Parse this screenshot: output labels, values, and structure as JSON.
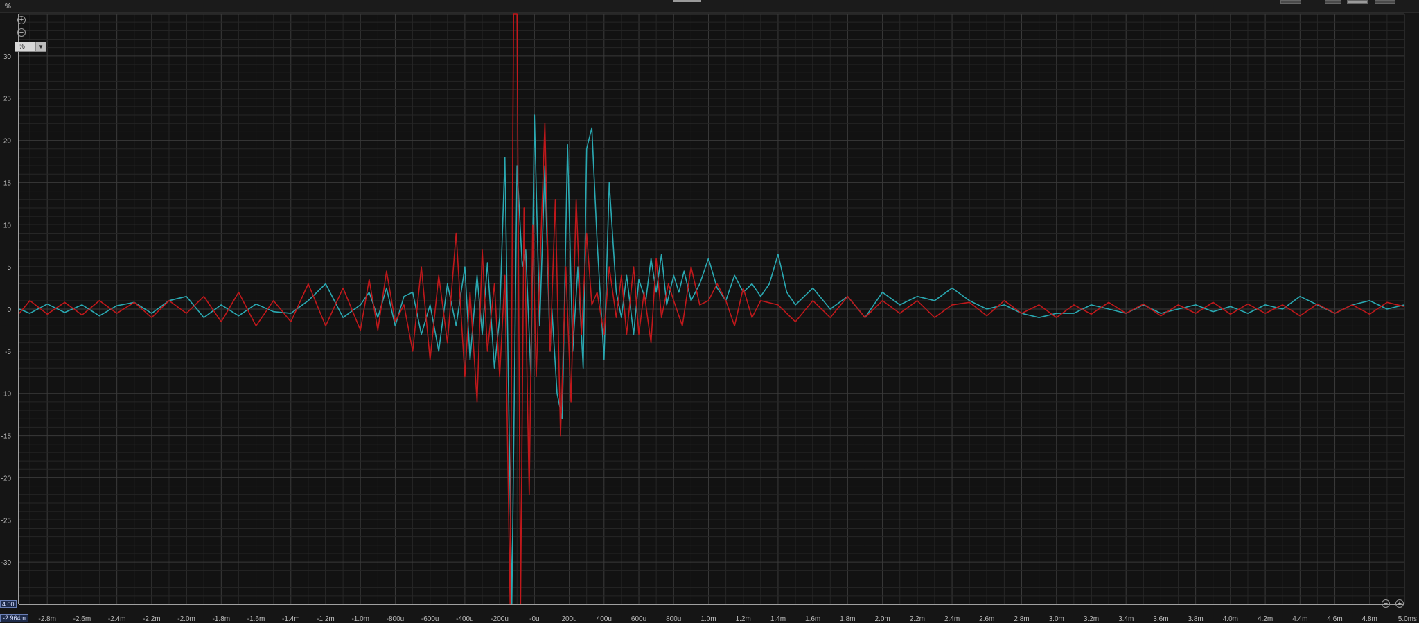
{
  "toolbar": {
    "unit_label": "%"
  },
  "controls": {
    "zoom_in_icon": "circle-plus-icon",
    "zoom_out_icon": "circle-minus-icon",
    "unit_select_value": "%",
    "cursor_x_readout": "-2.964m",
    "cursor_y_readout": "4.00"
  },
  "colors": {
    "background": "#121212",
    "grid_major": "#3a3a3a",
    "grid_minor": "#262626",
    "series_cyan": "#2aa9b2",
    "series_red": "#c0181b"
  },
  "chart_data": {
    "type": "line",
    "title": "",
    "xlabel": "",
    "ylabel": "%",
    "xlim": [
      -2.964,
      5.0
    ],
    "ylim": [
      -35,
      35
    ],
    "grid": true,
    "x_ticks": [
      "-2.8m",
      "-2.6m",
      "-2.4m",
      "-2.2m",
      "-2.0m",
      "-1.8m",
      "-1.6m",
      "-1.4m",
      "-1.2m",
      "-1.0m",
      "-800u",
      "-600u",
      "-400u",
      "-200u",
      "-0u",
      "200u",
      "400u",
      "600u",
      "800u",
      "1.0m",
      "1.2m",
      "1.4m",
      "1.6m",
      "1.8m",
      "2.0m",
      "2.2m",
      "2.4m",
      "2.6m",
      "2.8m",
      "3.0m",
      "3.2m",
      "3.4m",
      "3.6m",
      "3.8m",
      "4.0m",
      "4.2m",
      "4.4m",
      "4.6m",
      "4.8m",
      "5.0ms"
    ],
    "x_tick_values": [
      -2.8,
      -2.6,
      -2.4,
      -2.2,
      -2.0,
      -1.8,
      -1.6,
      -1.4,
      -1.2,
      -1.0,
      -0.8,
      -0.6,
      -0.4,
      -0.2,
      0,
      0.2,
      0.4,
      0.6,
      0.8,
      1.0,
      1.2,
      1.4,
      1.6,
      1.8,
      2.0,
      2.2,
      2.4,
      2.6,
      2.8,
      3.0,
      3.2,
      3.4,
      3.6,
      3.8,
      4.0,
      4.2,
      4.4,
      4.6,
      4.8,
      5.0
    ],
    "y_ticks": [
      "30",
      "25",
      "20",
      "15",
      "10",
      "5",
      "0",
      "-5",
      "-10",
      "-15",
      "-20",
      "-25",
      "-30",
      "-35"
    ],
    "y_tick_values": [
      30,
      25,
      20,
      15,
      10,
      5,
      0,
      -5,
      -10,
      -15,
      -20,
      -25,
      -30,
      -35
    ],
    "series": [
      {
        "color": "#2aa9b2",
        "x": [
          -2.96,
          -2.9,
          -2.8,
          -2.7,
          -2.6,
          -2.5,
          -2.4,
          -2.3,
          -2.2,
          -2.1,
          -2.0,
          -1.9,
          -1.8,
          -1.7,
          -1.6,
          -1.5,
          -1.4,
          -1.3,
          -1.2,
          -1.1,
          -1.0,
          -0.95,
          -0.9,
          -0.85,
          -0.8,
          -0.75,
          -0.7,
          -0.65,
          -0.6,
          -0.55,
          -0.5,
          -0.45,
          -0.4,
          -0.37,
          -0.33,
          -0.3,
          -0.27,
          -0.23,
          -0.2,
          -0.17,
          -0.13,
          -0.1,
          -0.07,
          -0.05,
          -0.02,
          0.0,
          0.03,
          0.06,
          0.09,
          0.1,
          0.13,
          0.16,
          0.19,
          0.22,
          0.25,
          0.28,
          0.3,
          0.33,
          0.36,
          0.4,
          0.43,
          0.47,
          0.5,
          0.53,
          0.57,
          0.6,
          0.64,
          0.67,
          0.7,
          0.73,
          0.76,
          0.8,
          0.83,
          0.86,
          0.9,
          0.95,
          1.0,
          1.05,
          1.1,
          1.15,
          1.2,
          1.25,
          1.3,
          1.35,
          1.4,
          1.45,
          1.5,
          1.6,
          1.7,
          1.8,
          1.9,
          2.0,
          2.1,
          2.2,
          2.3,
          2.4,
          2.5,
          2.6,
          2.7,
          2.8,
          2.9,
          3.0,
          3.1,
          3.2,
          3.3,
          3.4,
          3.5,
          3.6,
          3.7,
          3.8,
          3.9,
          4.0,
          4.1,
          4.2,
          4.3,
          4.4,
          4.5,
          4.6,
          4.7,
          4.8,
          4.9,
          5.0
        ],
        "y": [
          0,
          -0.5,
          0.6,
          -0.4,
          0.5,
          -0.8,
          0.4,
          0.8,
          -0.5,
          1.0,
          1.5,
          -1.0,
          0.5,
          -0.8,
          0.6,
          -0.3,
          -0.5,
          1.0,
          3.0,
          -1.0,
          0.5,
          2.0,
          -1.0,
          2.5,
          -2.0,
          1.5,
          2.0,
          -3.0,
          0.5,
          -5.0,
          3.0,
          -2.0,
          5.0,
          -6.0,
          4.0,
          -3.0,
          5.5,
          -7.0,
          -1.0,
          18.0,
          -35.0,
          17.0,
          5.0,
          7.0,
          -8.0,
          23.0,
          -2.0,
          17.0,
          -5.0,
          0.0,
          -10.0,
          -13.0,
          19.5,
          -5.0,
          5.0,
          -7.0,
          19.0,
          21.5,
          8.0,
          -6.0,
          15.0,
          2.0,
          -1.0,
          4.0,
          -3.0,
          3.5,
          1.0,
          6.0,
          2.0,
          6.5,
          0.5,
          4.0,
          2.0,
          4.5,
          1.0,
          3.0,
          6.0,
          2.5,
          1.0,
          4.0,
          2.0,
          3.0,
          1.5,
          3.0,
          6.5,
          2.0,
          0.5,
          2.5,
          0.0,
          1.5,
          -1.0,
          2.0,
          0.5,
          1.5,
          1.0,
          2.5,
          1.0,
          0.0,
          0.5,
          -0.5,
          -1.0,
          -0.5,
          -0.5,
          0.5,
          0.0,
          -0.5,
          0.5,
          -0.5,
          0.0,
          0.5,
          -0.3,
          0.3,
          -0.5,
          0.5,
          0.0,
          1.5,
          0.5,
          -0.5,
          0.5,
          1.0,
          0.0,
          0.5
        ]
      },
      {
        "color": "#c0181b",
        "x": [
          -2.96,
          -2.9,
          -2.8,
          -2.7,
          -2.6,
          -2.5,
          -2.4,
          -2.3,
          -2.2,
          -2.1,
          -2.0,
          -1.9,
          -1.8,
          -1.7,
          -1.6,
          -1.5,
          -1.4,
          -1.3,
          -1.2,
          -1.1,
          -1.0,
          -0.95,
          -0.9,
          -0.85,
          -0.8,
          -0.75,
          -0.7,
          -0.65,
          -0.6,
          -0.55,
          -0.5,
          -0.45,
          -0.4,
          -0.37,
          -0.33,
          -0.3,
          -0.27,
          -0.23,
          -0.2,
          -0.17,
          -0.14,
          -0.12,
          -0.1,
          -0.08,
          -0.06,
          -0.03,
          -0.01,
          0.01,
          0.03,
          0.06,
          0.09,
          0.12,
          0.15,
          0.18,
          0.21,
          0.24,
          0.27,
          0.3,
          0.33,
          0.36,
          0.4,
          0.43,
          0.47,
          0.5,
          0.53,
          0.57,
          0.6,
          0.63,
          0.67,
          0.7,
          0.73,
          0.77,
          0.8,
          0.85,
          0.9,
          0.95,
          1.0,
          1.05,
          1.1,
          1.15,
          1.2,
          1.25,
          1.3,
          1.4,
          1.5,
          1.6,
          1.7,
          1.8,
          1.9,
          2.0,
          2.1,
          2.2,
          2.3,
          2.4,
          2.5,
          2.6,
          2.7,
          2.8,
          2.9,
          3.0,
          3.1,
          3.2,
          3.3,
          3.4,
          3.5,
          3.6,
          3.7,
          3.8,
          3.9,
          4.0,
          4.1,
          4.2,
          4.3,
          4.4,
          4.5,
          4.6,
          4.7,
          4.8,
          4.9,
          5.0
        ],
        "y": [
          -0.5,
          1.0,
          -0.6,
          0.8,
          -0.7,
          1.0,
          -0.5,
          0.8,
          -1.0,
          1.0,
          -0.5,
          1.5,
          -1.5,
          2.0,
          -2.0,
          1.0,
          -1.5,
          3.0,
          -2.0,
          2.5,
          -2.5,
          3.5,
          -2.5,
          4.5,
          -1.5,
          0.5,
          -5.0,
          5.0,
          -6.0,
          4.0,
          -4.0,
          9.0,
          -8.0,
          2.0,
          -11.0,
          7.0,
          -5.0,
          3.0,
          -8.0,
          4.0,
          -35.0,
          35.0,
          35.0,
          -35.0,
          12.0,
          -22.0,
          10.0,
          -8.0,
          4.0,
          22.0,
          -5.0,
          13.0,
          -15.0,
          5.0,
          -11.0,
          13.0,
          -3.0,
          9.0,
          0.5,
          2.0,
          -3.0,
          5.0,
          -1.0,
          4.0,
          -3.0,
          5.0,
          -3.0,
          2.0,
          -4.0,
          6.0,
          -1.0,
          3.0,
          1.0,
          -2.0,
          5.0,
          0.5,
          1.0,
          3.0,
          1.0,
          -2.0,
          2.5,
          -1.0,
          1.0,
          0.5,
          -1.5,
          1.0,
          -1.0,
          1.5,
          -1.0,
          1.0,
          -0.5,
          1.0,
          -1.0,
          0.5,
          0.8,
          -0.8,
          1.0,
          -0.5,
          0.5,
          -1.0,
          0.5,
          -0.6,
          0.8,
          -0.5,
          0.6,
          -0.8,
          0.5,
          -0.5,
          0.8,
          -0.6,
          0.6,
          -0.5,
          0.5,
          -0.8,
          0.6,
          -0.5,
          0.5,
          -0.6,
          0.8,
          0.3
        ]
      }
    ]
  }
}
